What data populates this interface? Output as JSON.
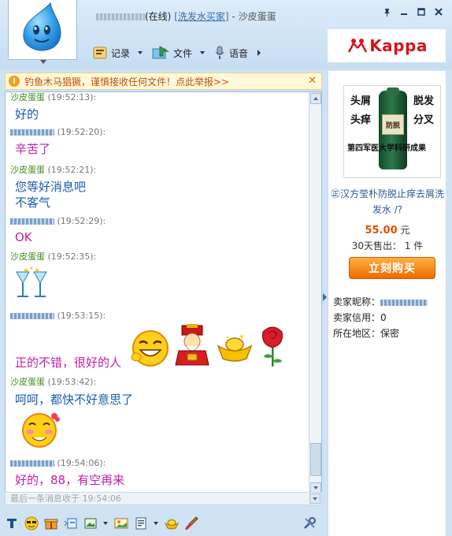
{
  "header": {
    "status": "(在线)",
    "tag_link": "[洗发水买家]",
    "separator": "-",
    "chat_partner": "沙皮蛋蛋",
    "toolbar": {
      "record_label": "记录",
      "file_label": "文件",
      "voice_label": "语音"
    }
  },
  "warning": {
    "text": "钓鱼木马猖獗，谨慎接收任何文件！点此举报>>"
  },
  "messages": [
    {
      "sender": "沙皮蛋蛋",
      "time": "(19:52:13):",
      "text": "好的",
      "color": "blue"
    },
    {
      "time": "(19:52:20):",
      "text": "辛苦了",
      "color": "pink"
    },
    {
      "sender": "沙皮蛋蛋",
      "time": "(19:52:21):",
      "text": "您等好消息吧",
      "color": "blue"
    },
    {
      "text": "不客气",
      "color": "blue"
    },
    {
      "time": "(19:52:29):",
      "text": "OK",
      "color": "pink"
    },
    {
      "sender": "沙皮蛋蛋",
      "time": "(19:52:35):"
    },
    {
      "time": "(19:53:15):",
      "text": "正的不错，很好的人",
      "color": "pink"
    },
    {
      "sender": "沙皮蛋蛋",
      "time": "(19:53:42):",
      "text": "呵呵，都快不好意思了",
      "color": "blue"
    },
    {
      "time": "(19:54:06):",
      "text": "好的，88，有空再来",
      "color": "pink"
    }
  ],
  "last_message": "最后一条消息收于 19:54:06",
  "ad": {
    "brand": "Kappa"
  },
  "product": {
    "img_words": [
      "头屑",
      "脱发",
      "头痒",
      "分叉"
    ],
    "img_caption": "第四军医大学科研成果",
    "bottle_label": "防脱",
    "title": "㊣汉方莹朴防脱止痒去屑洗发水 /?",
    "price": "55.00",
    "price_unit": "元",
    "sales": "30天售出： 1 件",
    "buy_label": "立刻购买"
  },
  "seller": {
    "nickname_label": "卖家昵称：",
    "credit_label": "卖家信用：",
    "credit_value": "0",
    "region_label": "所在地区：",
    "region_value": "保密"
  },
  "colors": {
    "blue_text": "#1a5bb0",
    "pink_text": "#c020a8",
    "name_green": "#3d8a1a",
    "brand_red": "#d4151b",
    "buy_orange": "#f06a00"
  }
}
